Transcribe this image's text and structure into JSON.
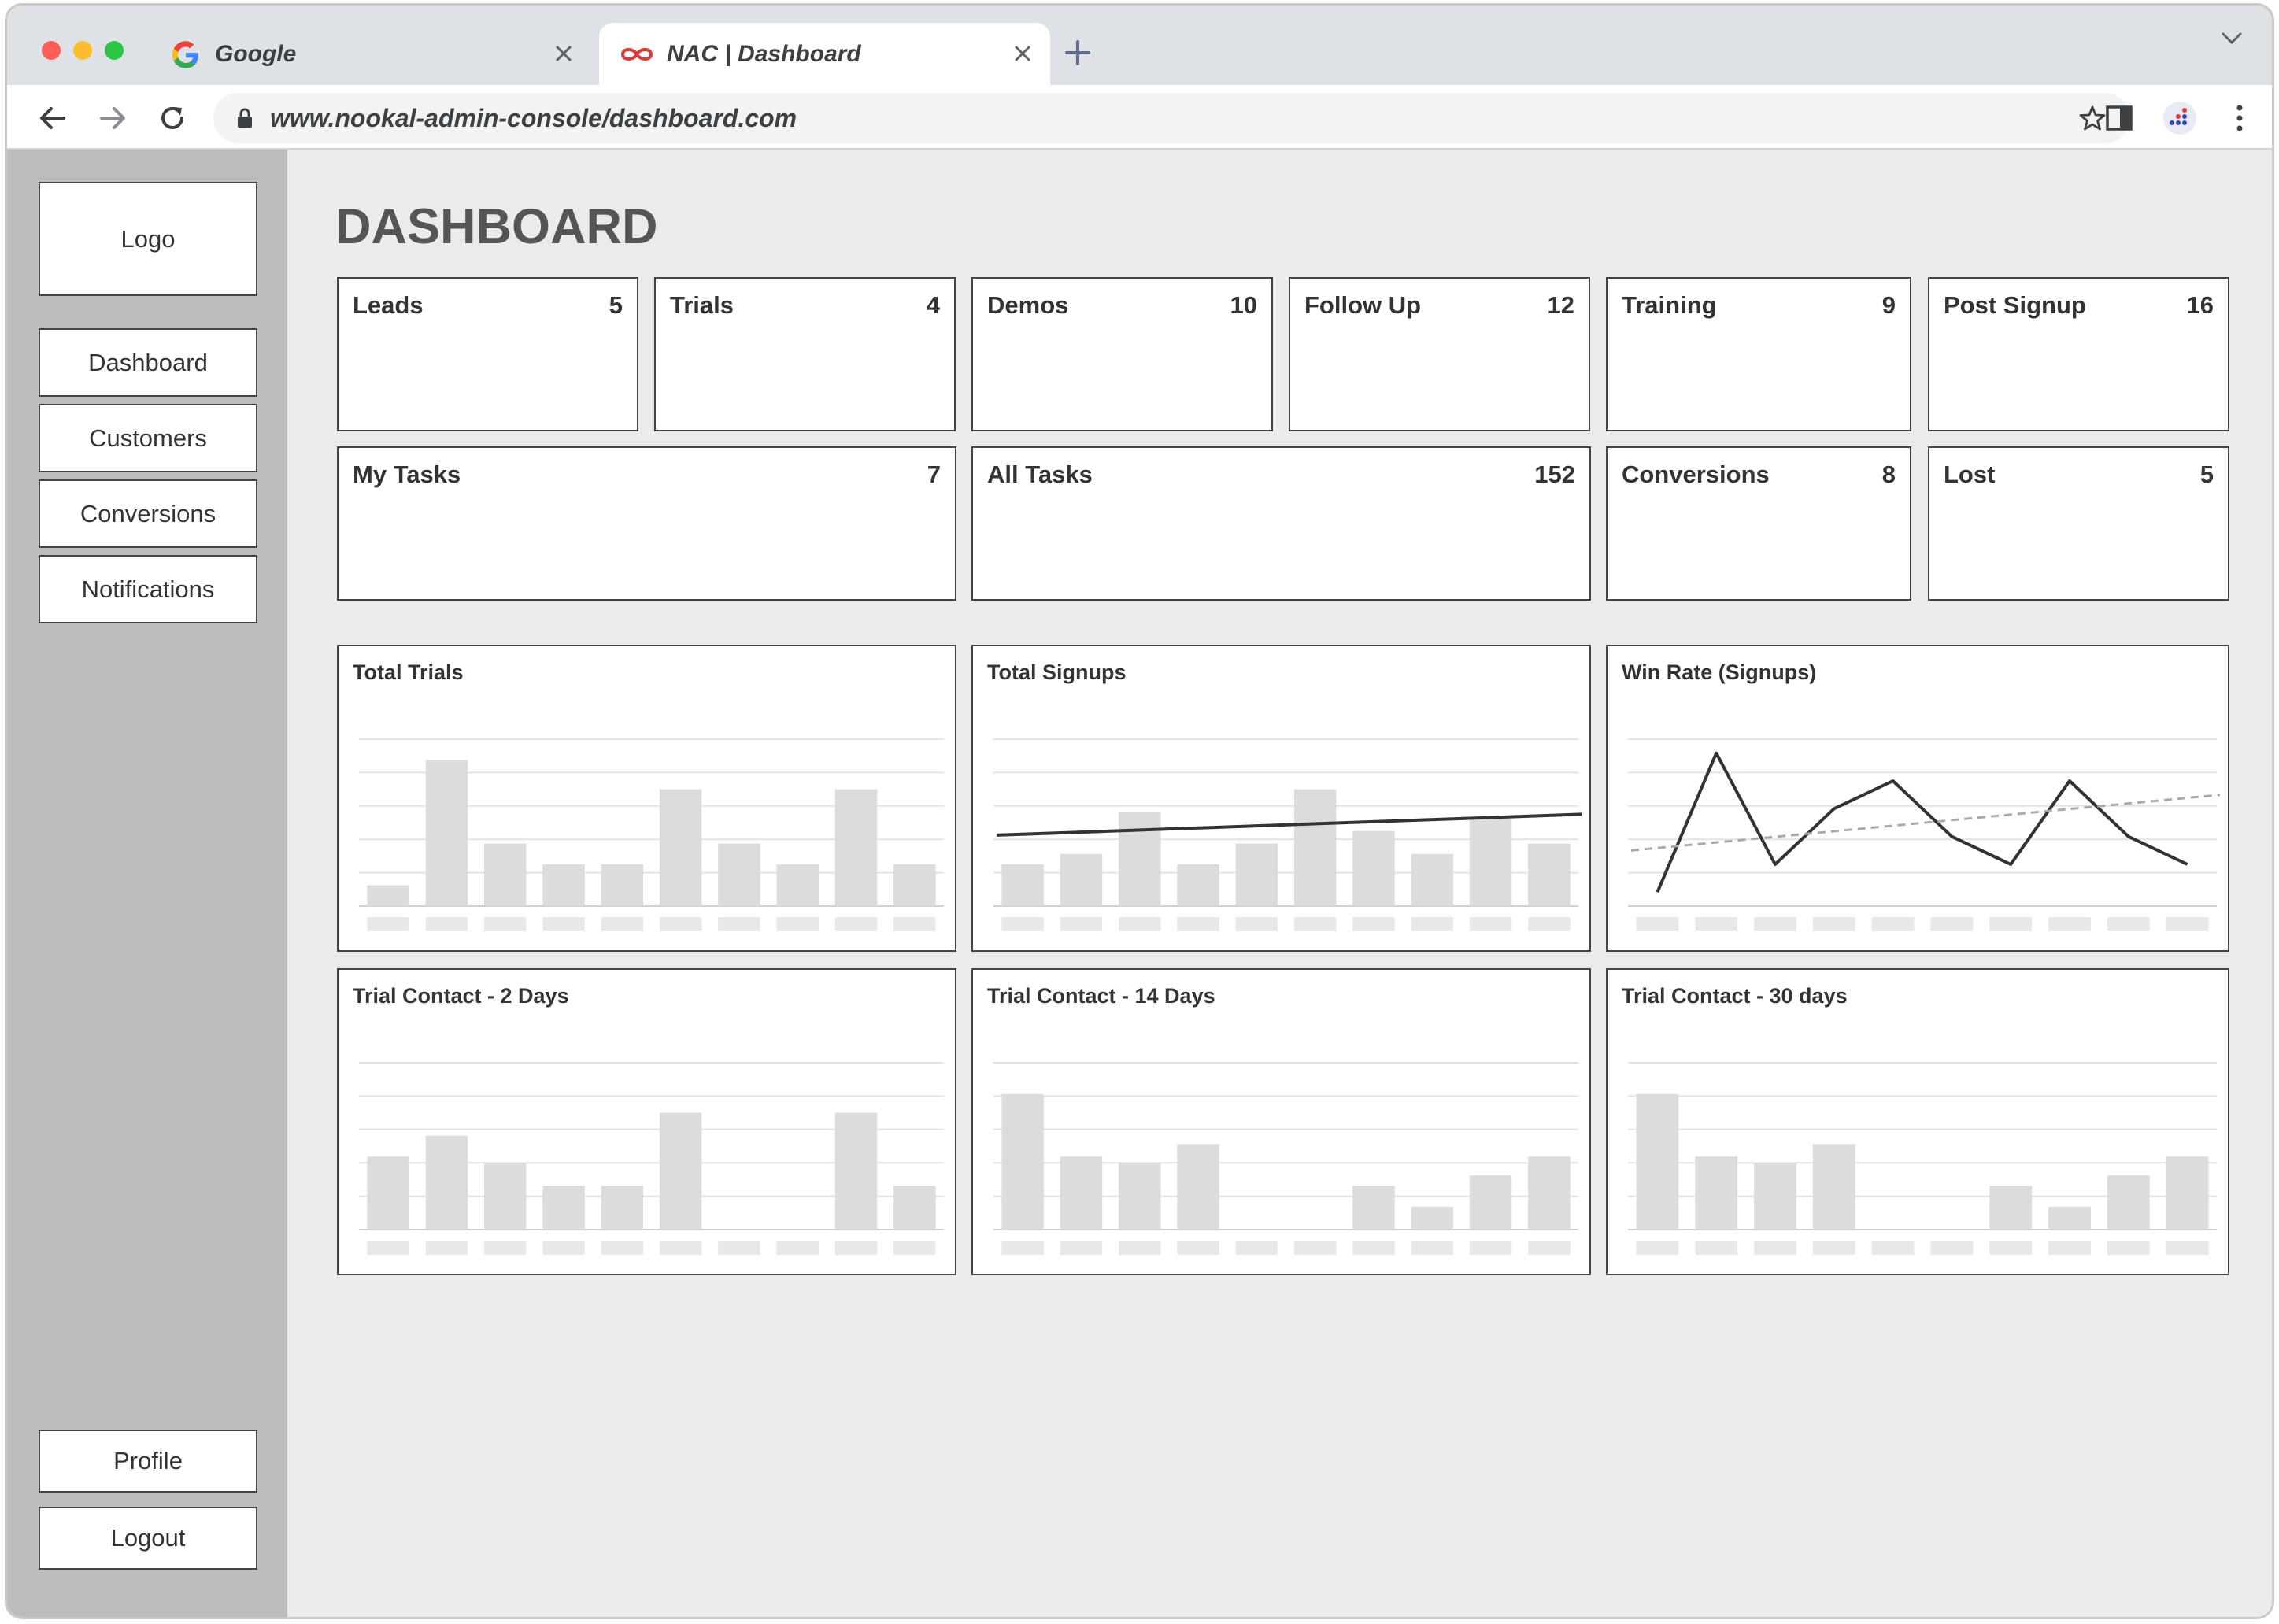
{
  "browser": {
    "tabs": [
      {
        "label": "Google",
        "active": false
      },
      {
        "label": "NAC | Dashboard",
        "active": true
      }
    ],
    "url": "www.nookal-admin-console/dashboard.com",
    "icons": [
      "back-icon",
      "forward-icon",
      "reload-icon",
      "lock-icon",
      "star-icon",
      "side-panel-icon",
      "extension-icon",
      "menu-icon"
    ],
    "colors": {
      "close": "#ff5f57",
      "minimize": "#febc2e",
      "maximize": "#28c840"
    }
  },
  "sidebar": {
    "logo": "Logo",
    "items": [
      {
        "label": "Dashboard"
      },
      {
        "label": "Customers"
      },
      {
        "label": "Conversions"
      },
      {
        "label": "Notifications"
      }
    ],
    "profile": "Profile",
    "logout": "Logout"
  },
  "main": {
    "title": "DASHBOARD",
    "stats_row1": [
      {
        "label": "Leads",
        "value": "5"
      },
      {
        "label": "Trials",
        "value": "4"
      },
      {
        "label": "Demos",
        "value": "10"
      },
      {
        "label": "Follow Up",
        "value": "12"
      },
      {
        "label": "Training",
        "value": "9"
      },
      {
        "label": "Post Signup",
        "value": "16"
      }
    ],
    "stats_row2": [
      {
        "label": "My Tasks",
        "value": "7"
      },
      {
        "label": "All Tasks",
        "value": "152"
      },
      {
        "label": "Conversions",
        "value": "8"
      },
      {
        "label": "Lost",
        "value": "5"
      }
    ]
  },
  "chart_data": [
    {
      "type": "bar",
      "title": "Total Trials",
      "values": [
        1,
        7,
        3,
        2,
        2,
        5.6,
        3,
        2,
        5.6,
        2
      ],
      "ylim": [
        0,
        8
      ],
      "grid": true
    },
    {
      "type": "bar",
      "title": "Total Signups",
      "values": [
        2,
        2.5,
        4.5,
        2,
        3,
        5.6,
        3.6,
        2.5,
        4.2,
        3
      ],
      "trend": [
        3.4,
        4.4
      ],
      "ylim": [
        0,
        8
      ],
      "grid": true
    },
    {
      "type": "line",
      "title": "Win Rate (Signups)",
      "values": [
        0.5,
        5.5,
        1.5,
        3.5,
        4.5,
        2.5,
        1.5,
        4.5,
        2.5,
        1.5
      ],
      "trend": [
        2.0,
        4.0
      ],
      "ylim": [
        0,
        6
      ],
      "grid": true
    },
    {
      "type": "bar",
      "title": "Trial Contact - 2 Days",
      "values": [
        3.5,
        4.5,
        3.2,
        2.1,
        2.1,
        5.6,
        0,
        0,
        5.6,
        2.1
      ],
      "ylim": [
        0,
        8
      ],
      "grid": true
    },
    {
      "type": "bar",
      "title": "Trial Contact - 14 Days",
      "values": [
        6.5,
        3.5,
        3.2,
        4.1,
        0,
        0,
        2.1,
        1.1,
        2.6,
        3.5
      ],
      "ylim": [
        0,
        8
      ],
      "grid": true
    },
    {
      "type": "bar",
      "title": "Trial Contact - 30 days",
      "values": [
        6.5,
        3.5,
        3.2,
        4.1,
        0,
        0,
        2.1,
        1.1,
        2.6,
        3.5
      ],
      "ylim": [
        0,
        8
      ],
      "grid": true
    }
  ]
}
